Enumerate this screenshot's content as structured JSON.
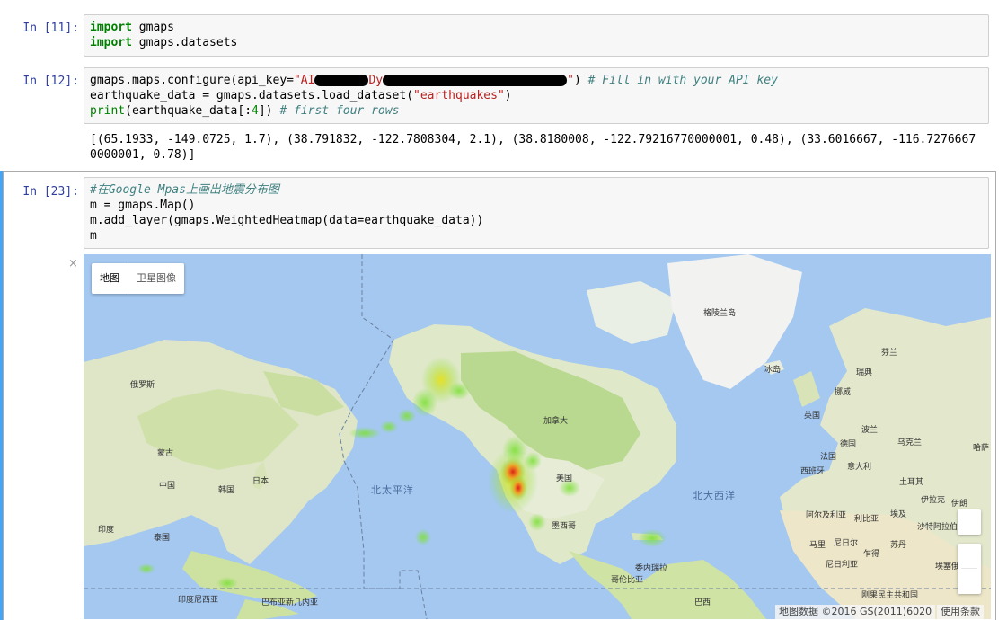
{
  "cells": [
    {
      "prompt": "In [11]:",
      "lines": [
        [
          {
            "t": "import",
            "c": "kw"
          },
          {
            "t": " gmaps",
            "c": ""
          }
        ],
        [
          {
            "t": "import",
            "c": "kw"
          },
          {
            "t": " gmaps.datasets",
            "c": ""
          }
        ]
      ]
    },
    {
      "prompt": "In [12]:",
      "line1_prefix": "gmaps.maps.configure(api_key=",
      "api_key_visible_start": "\"AI",
      "api_key_visible_mid": "Dy",
      "api_key_visible_end": "\"",
      "line1_suffix": ")",
      "line1_comment": " # Fill in with your API key",
      "line2_a": "earthquake_data = gmaps.datasets.load_dataset(",
      "line2_str": "\"earthquakes\"",
      "line2_b": ")",
      "line3_fn": "print",
      "line3_a": "(earthquake_data[:",
      "line3_num": "4",
      "line3_b": "])",
      "line3_comment": " # first four rows",
      "output": "[(65.1933, -149.0725, 1.7), (38.791832, -122.7808304, 2.1), (38.8180008, -122.79216770000001, 0.48), (33.6016667, -116.72766670000001, 0.78)]"
    },
    {
      "prompt": "In [23]:",
      "line1_comment": "#在Google Mpas上画出地震分布图",
      "line2": "m = gmaps.Map()",
      "line3": "m.add_layer(gmaps.WeightedHeatmap(data=earthquake_data))",
      "line4": "m"
    }
  ],
  "map": {
    "close_icon": "×",
    "map_type_active": "地图",
    "map_type_inactive": "卫星图像",
    "ocean_pacific": "北太平洋",
    "ocean_atlantic": "北大西洋",
    "labels": [
      {
        "key": "greenland",
        "text": "格陵兰岛"
      },
      {
        "key": "iceland",
        "text": "冰岛"
      },
      {
        "key": "russia",
        "text": "俄罗斯"
      },
      {
        "key": "canada",
        "text": "加拿大"
      },
      {
        "key": "usa",
        "text": "美国"
      },
      {
        "key": "mexico",
        "text": "墨西哥"
      },
      {
        "key": "mongolia",
        "text": "蒙古"
      },
      {
        "key": "china",
        "text": "中国"
      },
      {
        "key": "korea",
        "text": "韩国"
      },
      {
        "key": "japan",
        "text": "日本"
      },
      {
        "key": "india",
        "text": "印度"
      },
      {
        "key": "thailand",
        "text": "泰国"
      },
      {
        "key": "indonesia",
        "text": "印度尼西亚"
      },
      {
        "key": "png",
        "text": "巴布亚新几内亚"
      },
      {
        "key": "venezuela",
        "text": "委内瑞拉"
      },
      {
        "key": "colombia",
        "text": "哥伦比亚"
      },
      {
        "key": "brazil",
        "text": "巴西"
      },
      {
        "key": "finland",
        "text": "芬兰"
      },
      {
        "key": "sweden",
        "text": "瑞典"
      },
      {
        "key": "norway",
        "text": "挪威"
      },
      {
        "key": "uk",
        "text": "英国"
      },
      {
        "key": "germany",
        "text": "德国"
      },
      {
        "key": "poland",
        "text": "波兰"
      },
      {
        "key": "ukraine",
        "text": "乌克兰"
      },
      {
        "key": "kazakhstan",
        "text": "哈萨"
      },
      {
        "key": "france",
        "text": "法国"
      },
      {
        "key": "italy",
        "text": "意大利"
      },
      {
        "key": "spain",
        "text": "西班牙"
      },
      {
        "key": "turkey",
        "text": "土耳其"
      },
      {
        "key": "iraq",
        "text": "伊拉克"
      },
      {
        "key": "iran",
        "text": "伊朗"
      },
      {
        "key": "algeria",
        "text": "阿尔及利亚"
      },
      {
        "key": "libya",
        "text": "利比亚"
      },
      {
        "key": "egypt",
        "text": "埃及"
      },
      {
        "key": "saudi",
        "text": "沙特阿拉伯"
      },
      {
        "key": "mali",
        "text": "马里"
      },
      {
        "key": "niger",
        "text": "尼日尔"
      },
      {
        "key": "chad",
        "text": "乍得"
      },
      {
        "key": "sudan",
        "text": "苏丹"
      },
      {
        "key": "nigeria",
        "text": "尼日利亚"
      },
      {
        "key": "ethiopia",
        "text": "埃塞俄比亚"
      },
      {
        "key": "drc",
        "text": "刚果民主共和国"
      }
    ],
    "attribution": "地图数据 ©2016 GS(2011)6020",
    "terms": "使用条款"
  }
}
